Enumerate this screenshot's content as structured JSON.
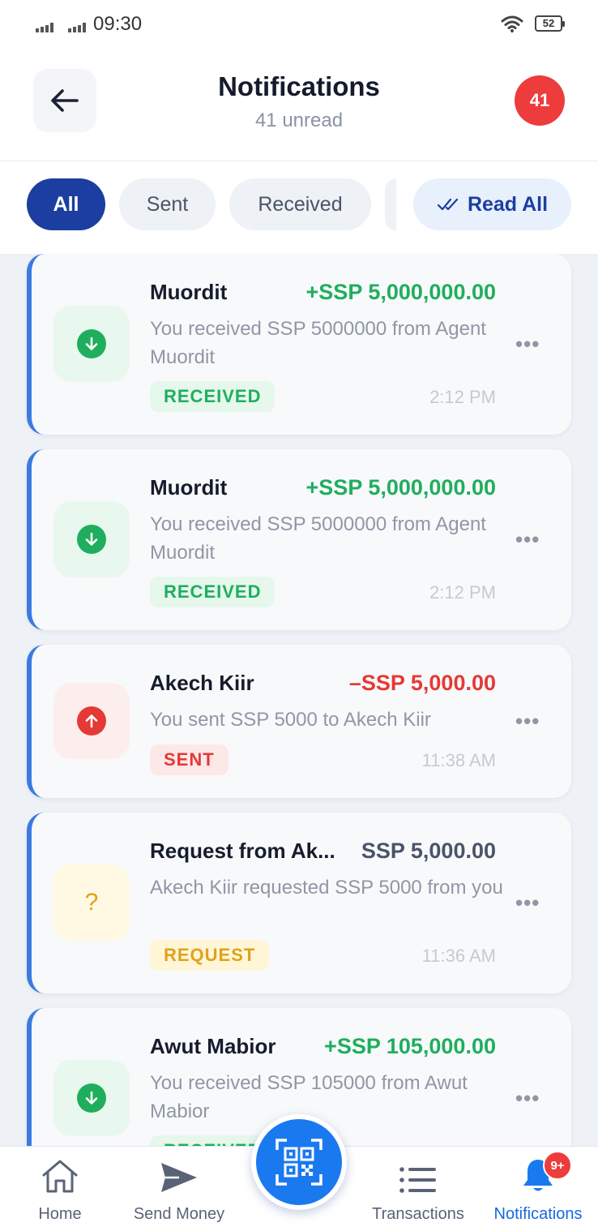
{
  "status_bar": {
    "time": "09:30",
    "battery": "52"
  },
  "header": {
    "title": "Notifications",
    "subtitle": "41 unread",
    "unread_badge": "41"
  },
  "filters": {
    "chips": [
      {
        "label": "All",
        "active": true
      },
      {
        "label": "Sent",
        "active": false
      },
      {
        "label": "Received",
        "active": false
      }
    ],
    "read_all_label": "Read All"
  },
  "notifications": [
    {
      "name": "Muordit",
      "amount": "+SSP 5,000,000.00",
      "amount_type": "credit",
      "description": "You received SSP 5000000 from Agent Muordit",
      "tag": "RECEIVED",
      "time": "2:12 PM",
      "icon": "arrow-down-icon"
    },
    {
      "name": "Muordit",
      "amount": "+SSP 5,000,000.00",
      "amount_type": "credit",
      "description": "You received SSP 5000000 from Agent Muordit",
      "tag": "RECEIVED",
      "time": "2:12 PM",
      "icon": "arrow-down-icon"
    },
    {
      "name": "Akech Kiir",
      "amount": "–SSP 5,000.00",
      "amount_type": "debit",
      "description": "You sent SSP 5000 to Akech Kiir",
      "tag": "SENT",
      "time": "11:38 AM",
      "icon": "arrow-up-icon"
    },
    {
      "name": "Request from Ak...",
      "amount": "SSP 5,000.00",
      "amount_type": "request",
      "description": "Akech Kiir requested SSP 5000 from you",
      "tag": "REQUEST",
      "time": "11:36 AM",
      "icon": "question-icon",
      "question_mark": "?"
    },
    {
      "name": "Awut Mabior",
      "amount": "+SSP 105,000.00",
      "amount_type": "credit",
      "description": "You received SSP 105000 from Awut Mabior",
      "tag": "RECEIVED",
      "time": "",
      "icon": "arrow-down-icon"
    }
  ],
  "more_glyph": "•••",
  "bottom_nav": {
    "items": [
      {
        "label": "Home",
        "icon": "home-icon"
      },
      {
        "label": "Send Money",
        "icon": "send-icon"
      },
      {
        "label": "Transactions",
        "icon": "list-icon"
      },
      {
        "label": "Notifications",
        "icon": "bell-icon",
        "active": true
      }
    ],
    "notifications_badge": "9+",
    "scan_icon": "qr-code-icon"
  },
  "colors": {
    "primary": "#1b3ea0",
    "accent": "#1b79f0",
    "credit": "#1fae5e",
    "debit": "#e53935",
    "request": "#e0a21a",
    "badge": "#ee3b3b"
  }
}
